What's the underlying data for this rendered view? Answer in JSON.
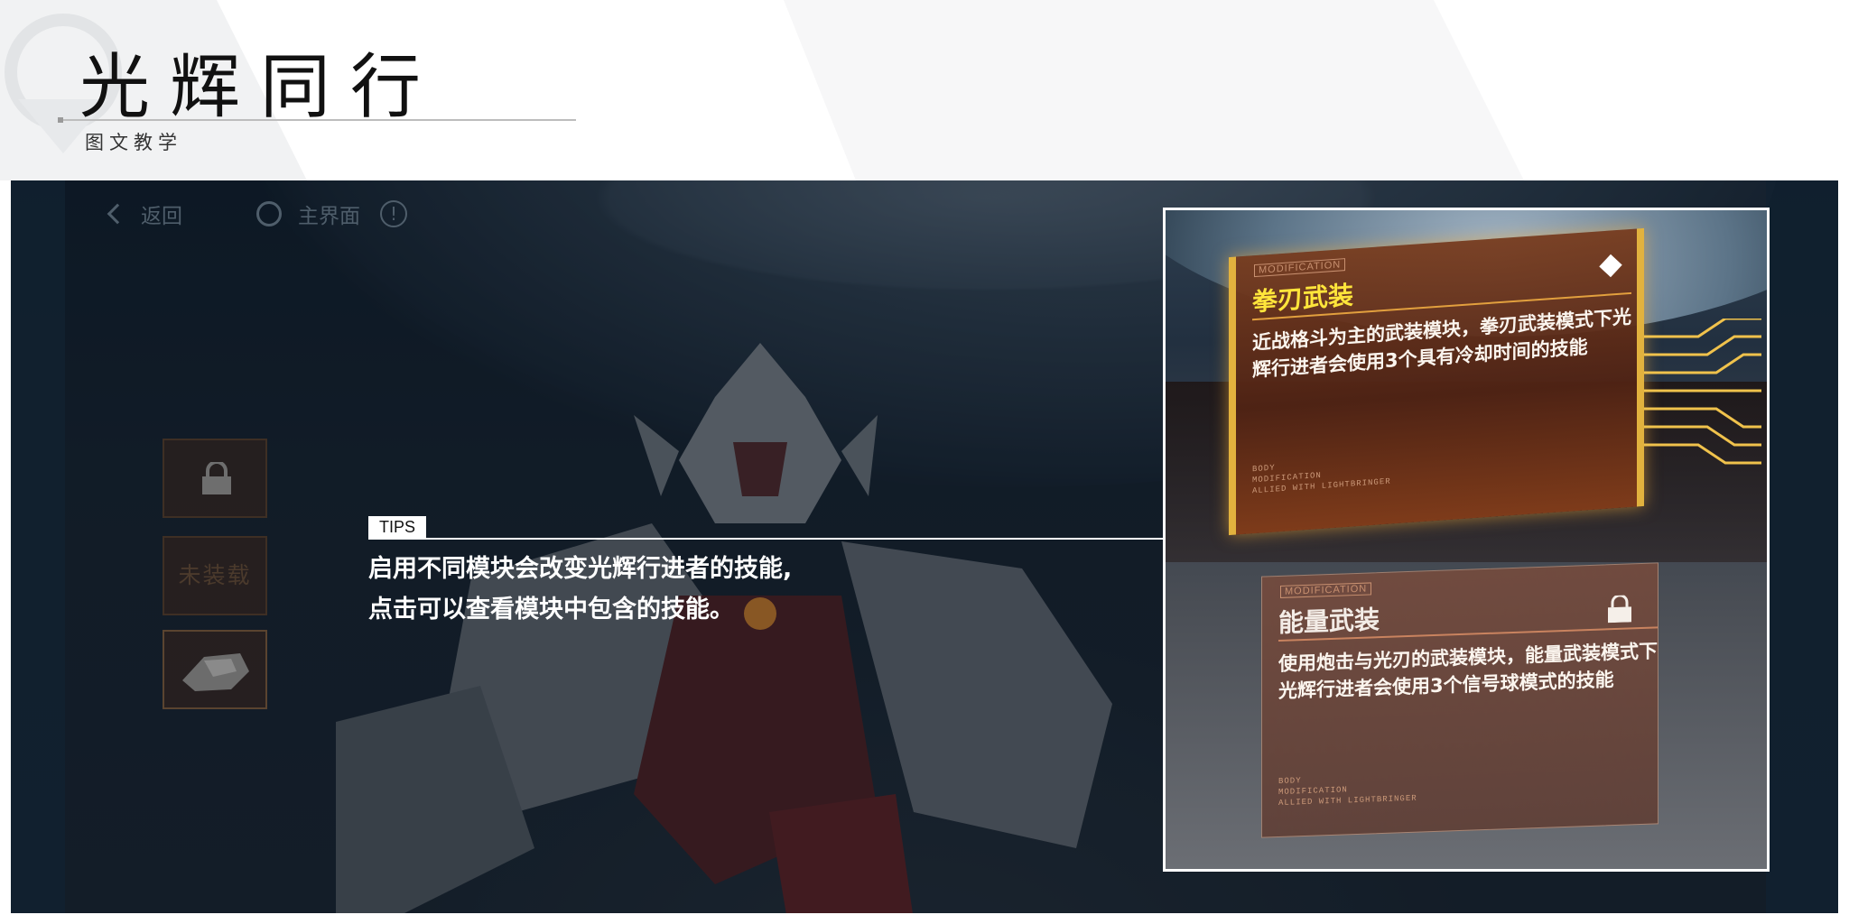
{
  "header": {
    "title": "光辉同行",
    "subtitle": "图文教学"
  },
  "topbar": {
    "back_label": "返回",
    "home_label": "主界面"
  },
  "slots": {
    "empty_label": "未装载"
  },
  "tips": {
    "tag": "TIPS",
    "line1": "启用不同模块会改变光辉行进者的技能,",
    "line2": "点击可以查看模块中包含的技能。"
  },
  "modules": [
    {
      "tag": "MODIFICATION",
      "title": "拳刃武装",
      "desc": "近战格斗为主的武装模块，拳刃武装模式下光辉行进者会使用3个具有冷却时间的技能",
      "fine1": "BODY",
      "fine2": "MODIFICATION",
      "fine3": "ALLIED WITH LIGHTBRINGER"
    },
    {
      "tag": "MODIFICATION",
      "title": "能量武装",
      "desc": "使用炮击与光刃的武装模块，能量武装模式下光辉行进者会使用3个信号球模式的技能",
      "fine1": "BODY",
      "fine2": "MODIFICATION",
      "fine3": "ALLIED WITH LIGHTBRINGER"
    }
  ],
  "colors": {
    "accent_gold": "#e2b23e",
    "title_yellow": "#ffe53b",
    "tips_text": "#ffffff"
  }
}
